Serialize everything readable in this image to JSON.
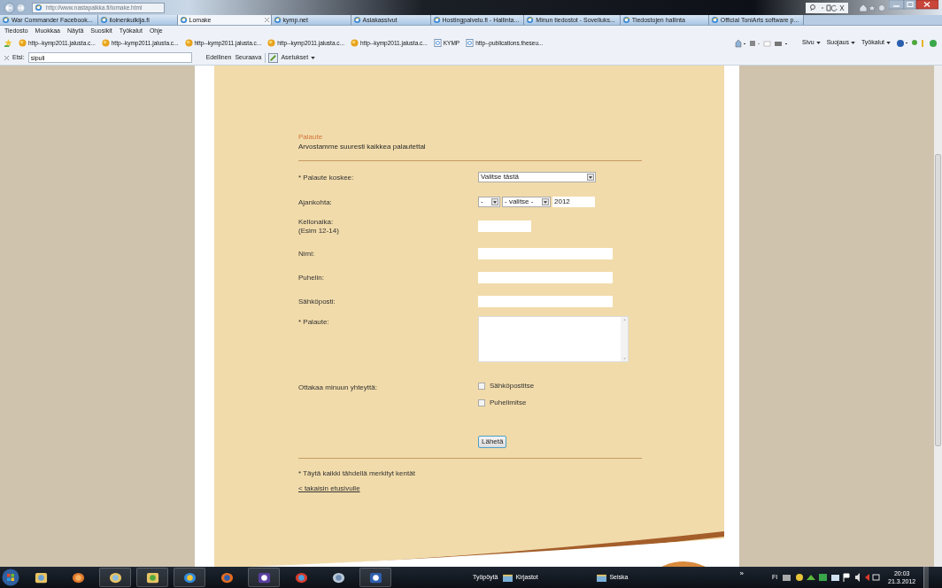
{
  "browser": {
    "address": "http://www.nastapaikka.fi/lomake.html",
    "tabs": [
      {
        "label": "War Commander Facebook...",
        "selected": false
      },
      {
        "label": "iloinenkulkija.fi",
        "selected": false
      },
      {
        "label": "Lomake",
        "selected": true
      },
      {
        "label": "kymp.net",
        "selected": false
      },
      {
        "label": "Asiakassivut",
        "selected": false
      },
      {
        "label": "Hostingpalvelu.fi - Hallinta...",
        "selected": false
      },
      {
        "label": "Minun tiedostot - Sovelluks...",
        "selected": false
      },
      {
        "label": "Tiedostojen hallinta",
        "selected": false
      },
      {
        "label": "Official ToniArts software p...",
        "selected": false
      }
    ],
    "menu": [
      "Tiedosto",
      "Muokkaa",
      "Näytä",
      "Suosikit",
      "Työkalut",
      "Ohje"
    ],
    "favorites": [
      "http--kymp2011.jalusta.c...",
      "http--kymp2011.jalusta.c...",
      "http--kymp2011.jalusta.c...",
      "http--kymp2011.jalusta.c...",
      "http--kymp2011.jalusta.c...",
      "KYMP",
      "http--publications.theseu..."
    ],
    "command_bar": [
      "Sivu",
      "Suojaus",
      "Työkalut"
    ],
    "find_bar": {
      "label": "Etsi:",
      "value": "sipuli",
      "buttons": [
        "Edellinen",
        "Seuraava",
        "Asetukset"
      ]
    }
  },
  "form": {
    "heading": "Palaute",
    "subtitle": "Arvostamme suuresti kaikkea palautettal",
    "fields": [
      {
        "kind": "select",
        "label": "* Palaute koskee:",
        "value": "Valitse tästä"
      },
      {
        "kind": "date",
        "label": "Ajankohta:",
        "day": "-",
        "month": "- valitse -",
        "year": "2012"
      },
      {
        "kind": "short",
        "label": "Kellonaika:",
        "note": "(Esim 12-14)"
      },
      {
        "kind": "text",
        "label": "Nimi:"
      },
      {
        "kind": "text",
        "label": "Puhelin:"
      },
      {
        "kind": "text",
        "label": "Sähköposti:"
      },
      {
        "kind": "textarea",
        "label": "* Palaute:"
      },
      {
        "kind": "checkboxes",
        "label": "Ottakaa minuun yhteyttä:",
        "options": [
          {
            "label": "Sähköpostitse",
            "checked": false
          },
          {
            "label": "Puhelimitse",
            "checked": false
          }
        ]
      }
    ],
    "submit": "Lähetä",
    "footnote": "* Täytä kaikki tähdellä merkityt kentät",
    "back_link": "< takaisin etusivulle"
  },
  "taskbar": {
    "toolbar": "Työpöytä",
    "tasks": [
      "Kirjastot",
      "Seiska"
    ],
    "overflow": "»",
    "language": "FI",
    "time": "20:03",
    "date": "21.3.2012"
  }
}
